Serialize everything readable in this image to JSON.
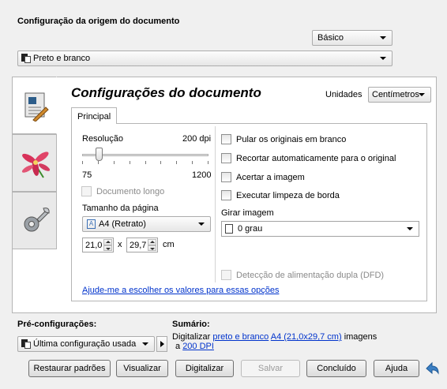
{
  "source_section": {
    "title": "Configuração da origem do documento",
    "mode_select": "Básico",
    "source_select": "Preto e branco"
  },
  "document_settings": {
    "title": "Configurações do documento",
    "units_label": "Unidades",
    "units_value": "Centímetros",
    "tab_principal": "Principal",
    "resolution_label": "Resolução",
    "resolution_value": "200 dpi",
    "slider_min": "75",
    "slider_max": "1200",
    "slider_level": 0.11,
    "long_document": "Documento longo",
    "page_size_label": "Tamanho da página",
    "page_size_value": "A4 (Retrato)",
    "width_value": "21,0",
    "times": "x",
    "height_value": "29,7",
    "size_unit": "cm",
    "options": [
      "Pular os originais em branco",
      "Recortar automaticamente para o original",
      "Acertar a imagem",
      "Executar limpeza de borda"
    ],
    "rotate_label": "Girar imagem",
    "rotate_value": "0 grau",
    "dfd": "Detecção de alimentação dupla (DFD)",
    "help_link": "Ajude-me a escolher os valores para essas opções"
  },
  "presets": {
    "label": "Pré-configurações:",
    "value": "Última configuração usada"
  },
  "summary": {
    "label": "Sumário:",
    "prefix": "Digitalizar",
    "color_link": "preto e branco",
    "size_link": "A4 (21,0x29,7 cm)",
    "middle": "imagens",
    "a": "a",
    "dpi_link": "200 DPI"
  },
  "buttons": {
    "restore": "Restaurar padrões",
    "preview": "Visualizar",
    "scan": "Digitalizar",
    "save": "Salvar",
    "done": "Concluído",
    "help": "Ajuda"
  },
  "colors": {
    "link": "#0033cc",
    "panel_bg": "#ffffff",
    "window_bg": "#f0f0f0"
  }
}
